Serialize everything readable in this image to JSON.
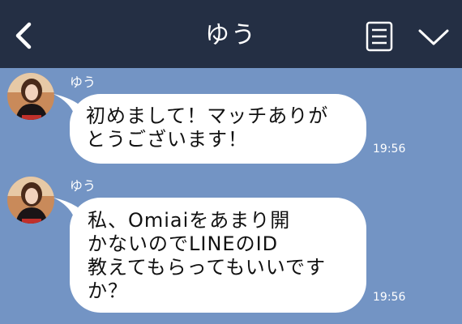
{
  "header": {
    "title": "ゆう",
    "bg_color": "#242f44",
    "back_icon": "chevron-left-icon",
    "menu_icon": "note-list-icon",
    "dropdown_icon": "chevron-down-icon"
  },
  "chat": {
    "bg_color": "#7394c4",
    "messages": [
      {
        "sender": "ゆう",
        "lines": [
          "初めまして！マッチありが",
          "とうございます！"
        ],
        "time": "19:56"
      },
      {
        "sender": "ゆう",
        "lines": [
          "私、Omiaiをあまり開",
          "かないのでLINEのID",
          "教えてもらってもいいです",
          "か？"
        ],
        "time": "19:56"
      }
    ]
  }
}
